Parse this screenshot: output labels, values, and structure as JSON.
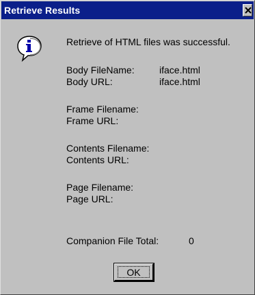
{
  "window": {
    "title": "Retrieve Results",
    "close_glyph": "✕"
  },
  "message": "Retrieve of HTML files was successful.",
  "icon": "information-icon",
  "fields": {
    "body_filename_label": "Body FileName:",
    "body_filename_value": "iface.html",
    "body_url_label": "Body URL:",
    "body_url_value": "iface.html",
    "frame_filename_label": "Frame Filename:",
    "frame_url_label": "Frame URL:",
    "contents_filename_label": "Contents Filename:",
    "contents_url_label": "Contents URL:",
    "page_filename_label": "Page Filename:",
    "page_url_label": "Page URL:",
    "companion_total_label": "Companion File Total:",
    "companion_total_value": "0"
  },
  "buttons": {
    "ok_label": "OK"
  },
  "colors": {
    "titlebar": "#0b1f8a",
    "dialog_face": "#c0c0c0"
  }
}
